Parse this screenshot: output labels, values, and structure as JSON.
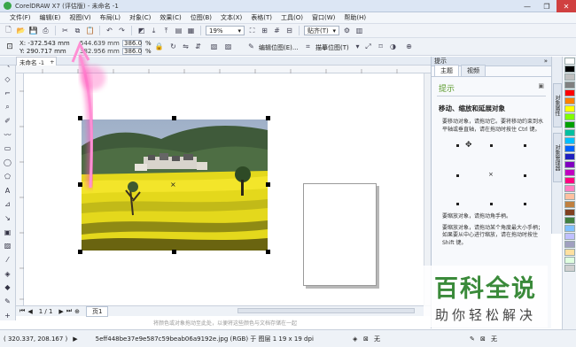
{
  "window": {
    "title": "CorelDRAW X7 (评估版) - 未命名 -1",
    "controls": [
      "—",
      "❐",
      "✕"
    ]
  },
  "menu": {
    "items": [
      "文件(F)",
      "编辑(E)",
      "视图(V)",
      "布局(L)",
      "对象(C)",
      "效果(C)",
      "位图(B)",
      "文本(X)",
      "表格(T)",
      "工具(O)",
      "窗口(W)",
      "帮助(H)"
    ]
  },
  "toolbar": {
    "zoom_value": "19%",
    "snap_label": "贴齐(T)"
  },
  "propbar": {
    "x_label": "X: -372.543 mm",
    "y_label": "Y: 290.717 mm",
    "w_label": "544.639 mm",
    "h_label": "382.956 mm",
    "scale_x": "386.0",
    "scale_y": "386.0",
    "pct": "%",
    "edit_bitmap_label": "编辑位图(E)...",
    "trace_bitmap_label": "描摹位图(T)"
  },
  "document": {
    "tab_label": "未命名 -1",
    "page_counter": "1 / 1",
    "page_tab": "页1"
  },
  "hint_bar": "将颜色或对象拖动至此处，以便将这些颜色与文档存储在一起",
  "status": {
    "coords": "( 320.337, 208.167 )",
    "info": "5eff448be37e9e587c59beab06a9192e.jpg (RGB) 于 图层 1 19 x 19 dpi",
    "fill_none": "无",
    "outline_none": "无"
  },
  "docker": {
    "header": "提示",
    "tabs": [
      "主题",
      "视频"
    ],
    "hint_title": "提示",
    "heading": "移动、缩放和延展对象",
    "para1": "要移动对象，请拖动它。要将移动约束到水平轴或垂直轴，请在拖动时按住 Ctrl 键。",
    "para2": "要缩放对象，请拖动角手柄。",
    "para3": "要缩放对象，请拖动某个角度最大小手柄；如果要从中心进行缩放，请在拖动时按住 Shift 键。"
  },
  "side_tabs": [
    "对象属性",
    "对象管理器"
  ],
  "watermark": {
    "main": "百科全说",
    "sub": "助你轻松解决"
  },
  "palette_colors": [
    "#ffffff",
    "#000000",
    "#bfbfbf",
    "#808080",
    "#ff0000",
    "#ff8000",
    "#ffff00",
    "#80ff00",
    "#00a000",
    "#00c0a0",
    "#00c0ff",
    "#0060ff",
    "#2020c0",
    "#8000c0",
    "#c000c0",
    "#ff0080",
    "#ff80c0",
    "#ffc0a0",
    "#c08040",
    "#804020",
    "#408040",
    "#80c0ff",
    "#c0c0ff",
    "#a0a0c0",
    "#ffe0a0",
    "#e0ffe0",
    "#d0d0d0"
  ]
}
